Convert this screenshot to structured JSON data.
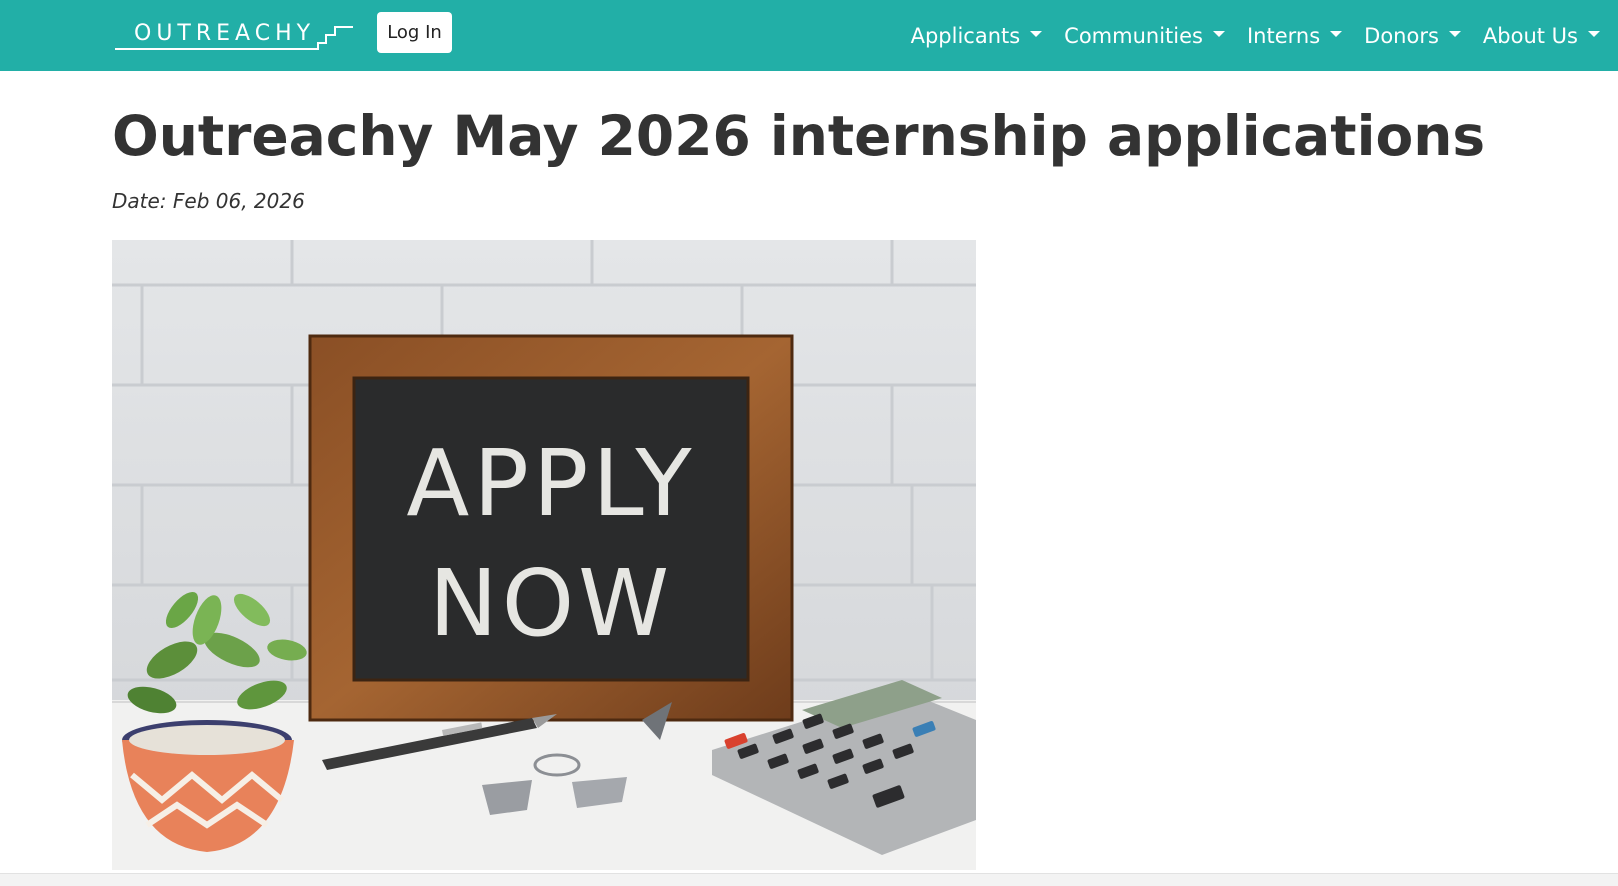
{
  "header": {
    "logo_text": "OUTREACHY",
    "login_label": "Log In",
    "nav": [
      {
        "label": "Applicants"
      },
      {
        "label": "Communities"
      },
      {
        "label": "Interns"
      },
      {
        "label": "Donors"
      },
      {
        "label": "About Us"
      }
    ]
  },
  "post": {
    "title": "Outreachy May 2026 internship applications",
    "date": "Date: Feb 06, 2026",
    "image": {
      "line1": "APPLY",
      "line2": "NOW"
    }
  },
  "colors": {
    "brand": "#22afa7",
    "text": "#333333"
  },
  "icons": [
    "chevron-down-icon",
    "calculator-icon",
    "pen-icon",
    "plant-icon",
    "binder-clip-icon"
  ]
}
